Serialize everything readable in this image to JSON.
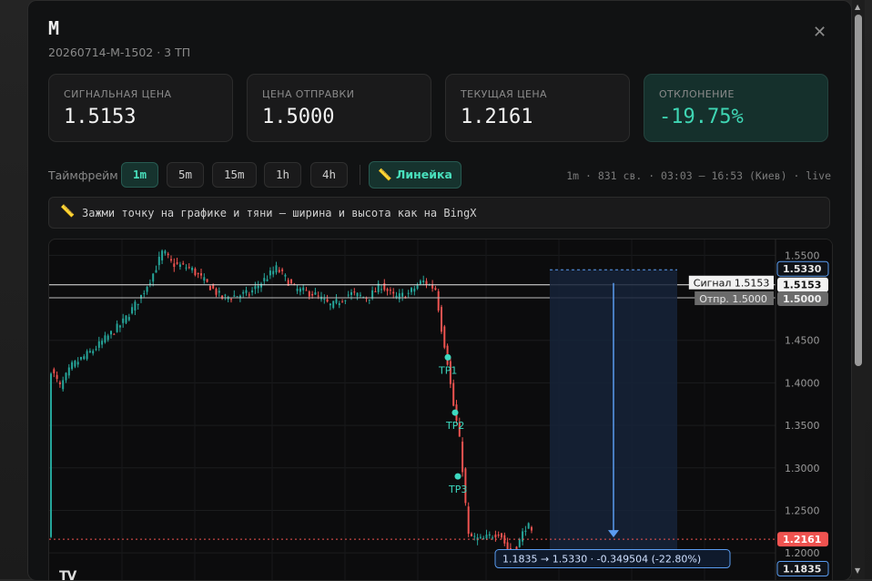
{
  "title": "M",
  "subtitle": "20260714-M-1502 · 3 ТП",
  "close_icon": "✕",
  "cards": [
    {
      "label": "СИГНАЛЬНАЯ ЦЕНА",
      "value": "1.5153"
    },
    {
      "label": "ЦЕНА ОТПРАВКИ",
      "value": "1.5000"
    },
    {
      "label": "ТЕКУЩАЯ ЦЕНА",
      "value": "1.2161"
    },
    {
      "label": "ОТКЛОНЕНИЕ",
      "value": "-19.75%"
    }
  ],
  "toolbar": {
    "timeframe_label": "Таймфрейм",
    "timeframes": [
      "1m",
      "5m",
      "15m",
      "1h",
      "4h"
    ],
    "active_timeframe": "1m",
    "ruler_label": "Линейка",
    "info": "1m · 831 св. · 03:03 – 16:53 (Киев) · live"
  },
  "hint": {
    "text": "Зажми точку на графике и тяни — ширина и высота как на BingX",
    "icon": "ruler-icon"
  },
  "chart_data": {
    "type": "candlestick",
    "interval": "1m",
    "ylim": [
      1.183,
      1.56
    ],
    "y_ticks": [
      "1.5500",
      "1.5000",
      "1.4500",
      "1.4000",
      "1.3500",
      "1.3000",
      "1.2500",
      "1.2000"
    ],
    "y_tick_values": [
      1.55,
      1.5,
      1.45,
      1.4,
      1.35,
      1.3,
      1.25,
      1.2
    ],
    "price_path": [
      [
        0,
        1.42
      ],
      [
        12,
        1.395
      ],
      [
        25,
        1.42
      ],
      [
        50,
        1.44
      ],
      [
        80,
        1.47
      ],
      [
        100,
        1.5
      ],
      [
        115,
        1.53
      ],
      [
        125,
        1.555
      ],
      [
        135,
        1.54
      ],
      [
        155,
        1.535
      ],
      [
        170,
        1.52
      ],
      [
        190,
        1.5
      ],
      [
        220,
        1.505
      ],
      [
        250,
        1.535
      ],
      [
        270,
        1.51
      ],
      [
        290,
        1.505
      ],
      [
        310,
        1.49
      ],
      [
        330,
        1.505
      ],
      [
        350,
        1.5
      ],
      [
        365,
        1.515
      ],
      [
        380,
        1.5
      ],
      [
        395,
        1.505
      ],
      [
        410,
        1.52
      ],
      [
        425,
        1.51
      ],
      [
        430,
        1.47
      ],
      [
        437,
        1.43
      ],
      [
        443,
        1.38
      ],
      [
        450,
        1.34
      ],
      [
        455,
        1.29
      ],
      [
        460,
        1.22
      ],
      [
        475,
        1.215
      ],
      [
        495,
        1.225
      ],
      [
        505,
        1.2
      ],
      [
        515,
        1.21
      ],
      [
        525,
        1.235
      ],
      [
        532,
        1.2161
      ]
    ],
    "signal_line": {
      "label": "Сигнал 1.5153",
      "value": 1.5153,
      "axis_label": "1.5153"
    },
    "send_line": {
      "label": "Отпр. 1.5000",
      "value": 1.5,
      "axis_label": "1.5000"
    },
    "current_price": {
      "value": 1.2161,
      "axis_label": "1.2161"
    },
    "take_profits": [
      {
        "label": "TP1",
        "price": 1.43
      },
      {
        "label": "TP2",
        "price": 1.365
      },
      {
        "label": "TP3",
        "price": 1.29
      }
    ],
    "ruler": {
      "from_price": 1.533,
      "to_price": 1.1835,
      "from_label": "1.5330",
      "to_label": "1.1835",
      "readout": "1.1835 → 1.5330 · -0.349504 (-22.80%)"
    },
    "colors": {
      "up": "#26a69a",
      "down": "#ef5350",
      "tp": "#3dd9c0",
      "ruler": "#5a9cf0",
      "current": "#ef5350"
    },
    "grid": true
  },
  "watermark": "TV"
}
